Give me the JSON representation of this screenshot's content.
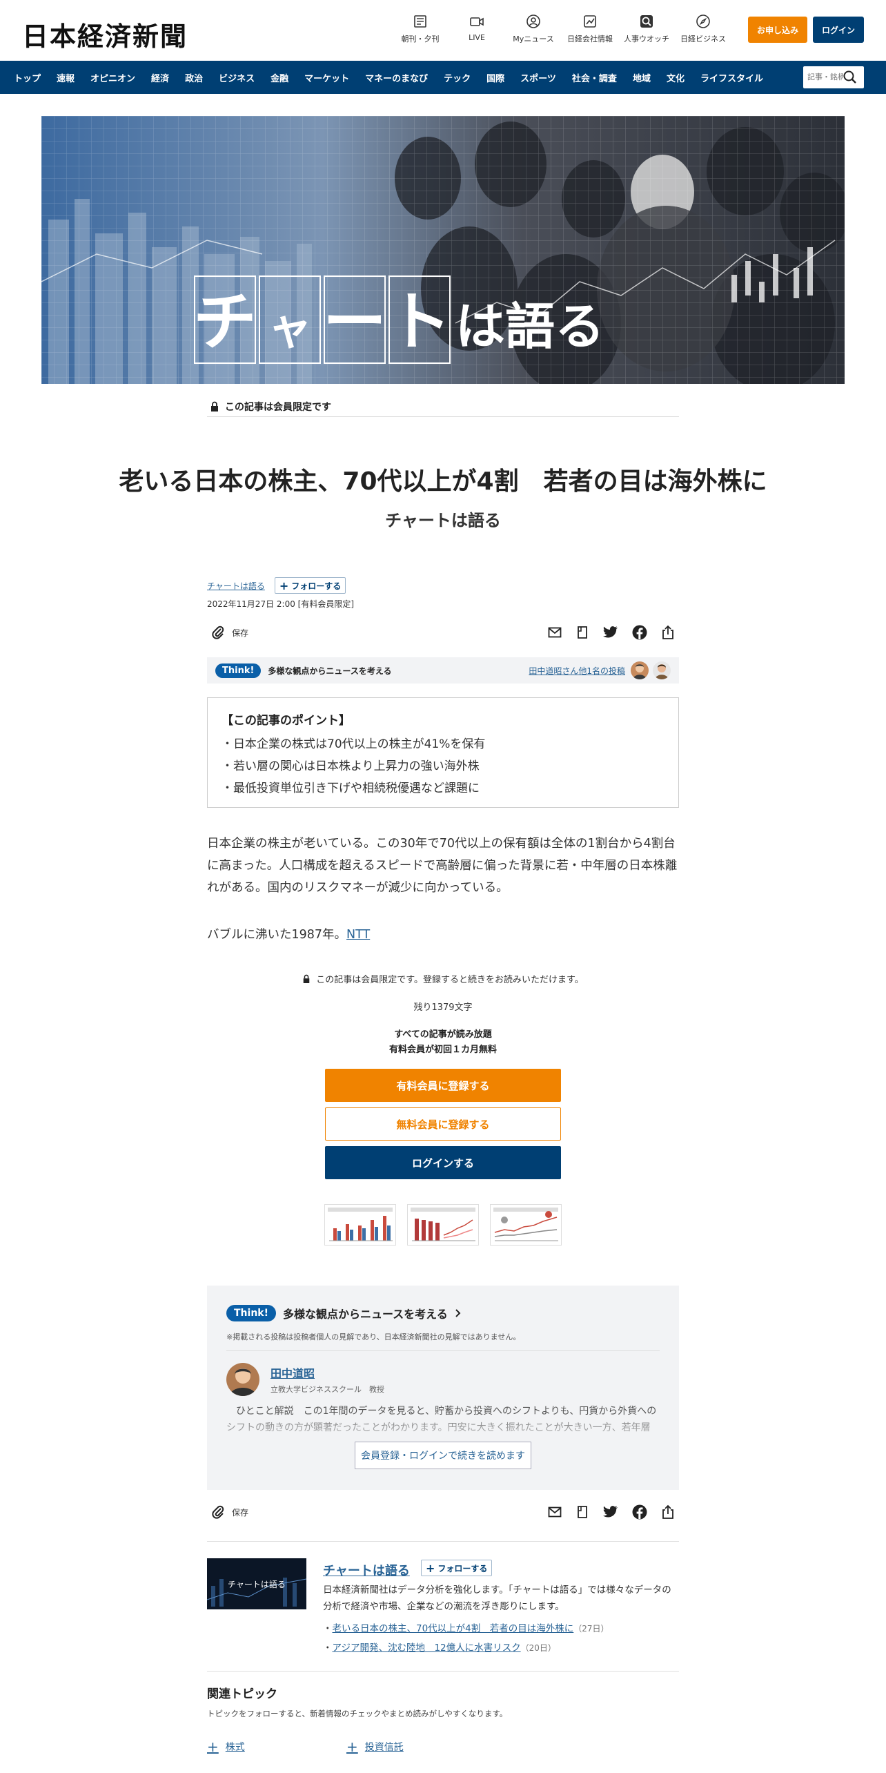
{
  "header": {
    "logo": "日本経済新聞",
    "quicklinks": [
      {
        "label": "朝刊・夕刊",
        "icon": "newspaper-icon"
      },
      {
        "label": "LIVE",
        "icon": "video-icon"
      },
      {
        "label": "Myニュース",
        "icon": "user-icon"
      },
      {
        "label": "日経会社情報",
        "icon": "chart-icon"
      },
      {
        "label": "人事ウオッチ",
        "icon": "search-person-icon"
      },
      {
        "label": "日経ビジネス",
        "icon": "compass-icon"
      }
    ],
    "subscribe_label": "お申し込み",
    "login_label": "ログイン"
  },
  "nav": {
    "items": [
      "トップ",
      "速報",
      "オピニオン",
      "経済",
      "政治",
      "ビジネス",
      "金融",
      "マーケット",
      "マネーのまなび",
      "テック",
      "国際",
      "スポーツ",
      "社会・調査",
      "地域",
      "文化",
      "ライフスタイル"
    ],
    "search_placeholder": "記事・銘柄"
  },
  "hero": {
    "title_boxed": [
      "チ",
      "ャ",
      "ー",
      "ト"
    ],
    "title_rest": "は語る"
  },
  "article": {
    "members_only": "この記事は会員限定です",
    "headline": "老いる日本の株主、70代以上が4割　若者の目は海外株に",
    "subhead": "チャートは語る",
    "series_link": "チャートは語る",
    "follow_label": "フォローする",
    "dateline": "2022年11月27日 2:00 [有料会員限定]",
    "save_label": "保存",
    "think_badge": "Think!",
    "think_text": "多様な観点からニュースを考える",
    "think_link": "田中道昭さん他1名の投稿",
    "points_title": "【この記事のポイント】",
    "points": [
      "・日本企業の株式は70代以上の株主が41%を保有",
      "・若い層の関心は日本株より上昇力の強い海外株",
      "・最低投資単位引き下げや相続税優遇など課題に"
    ],
    "para1": "日本企業の株主が老いている。この30年で70代以上の保有額は全体の1割台から4割台に高まった。人口構成を超えるスピードで高齢層に偏った背景に若・中年層の日本株離れがある。国内のリスクマネーが減少に向かっている。",
    "para2_text": "バブルに沸いた1987年。",
    "para2_link": "NTT"
  },
  "paywall": {
    "notice": "この記事は会員限定です。登録すると続きをお読みいただけます。",
    "remaining": "残り1379文字",
    "promo_line1": "すべての記事が読み放題",
    "promo_line2": "有料会員が初回１カ月無料",
    "paid_label": "有料会員に登録する",
    "free_label": "無料会員に登録する",
    "login_label": "ログインする"
  },
  "think_box": {
    "badge": "Think!",
    "title": "多様な観点からニュースを考える",
    "note": "※掲載される投稿は投稿者個人の見解であり、日本経済新聞社の見解ではありません。",
    "author_name": "田中道昭",
    "author_role": "立教大学ビジネススクール　教授",
    "comment_label": "ひとこと解説",
    "comment": "この1年間のデータを見ると、貯蓄から投資へのシフトよりも、円貨から外貨へのシフトの動きの方が顕著だったことがわかります。円安に大きく振れたことが大きい一方、若年層",
    "more_label": "会員登録・ログインで続きを読めます"
  },
  "series_box": {
    "image_text": "チャートは語る",
    "title": "チャートは語る",
    "follow_label": "フォローする",
    "description": "日本経済新聞社はデータ分析を強化します。「チャートは語る」では様々なデータの分析で経済や市場、企業などの潮流を浮き彫りにします。",
    "links": [
      {
        "text": "老いる日本の株主、70代以上が4割　若者の目は海外株に",
        "date": "（27日）"
      },
      {
        "text": "アジア開発、沈む陸地　12億人に水害リスク",
        "date": "（20日）"
      }
    ]
  },
  "related": {
    "title": "関連トピック",
    "subtitle": "トピックをフォローすると、新着情報のチェックやまとめ読みがしやすくなります。",
    "topics": [
      "株式",
      "投資信託"
    ]
  },
  "colors": {
    "brand_navy": "#003f73",
    "accent_orange": "#f08300",
    "link_blue": "#2a6496",
    "think_blue": "#0a5fa8"
  }
}
